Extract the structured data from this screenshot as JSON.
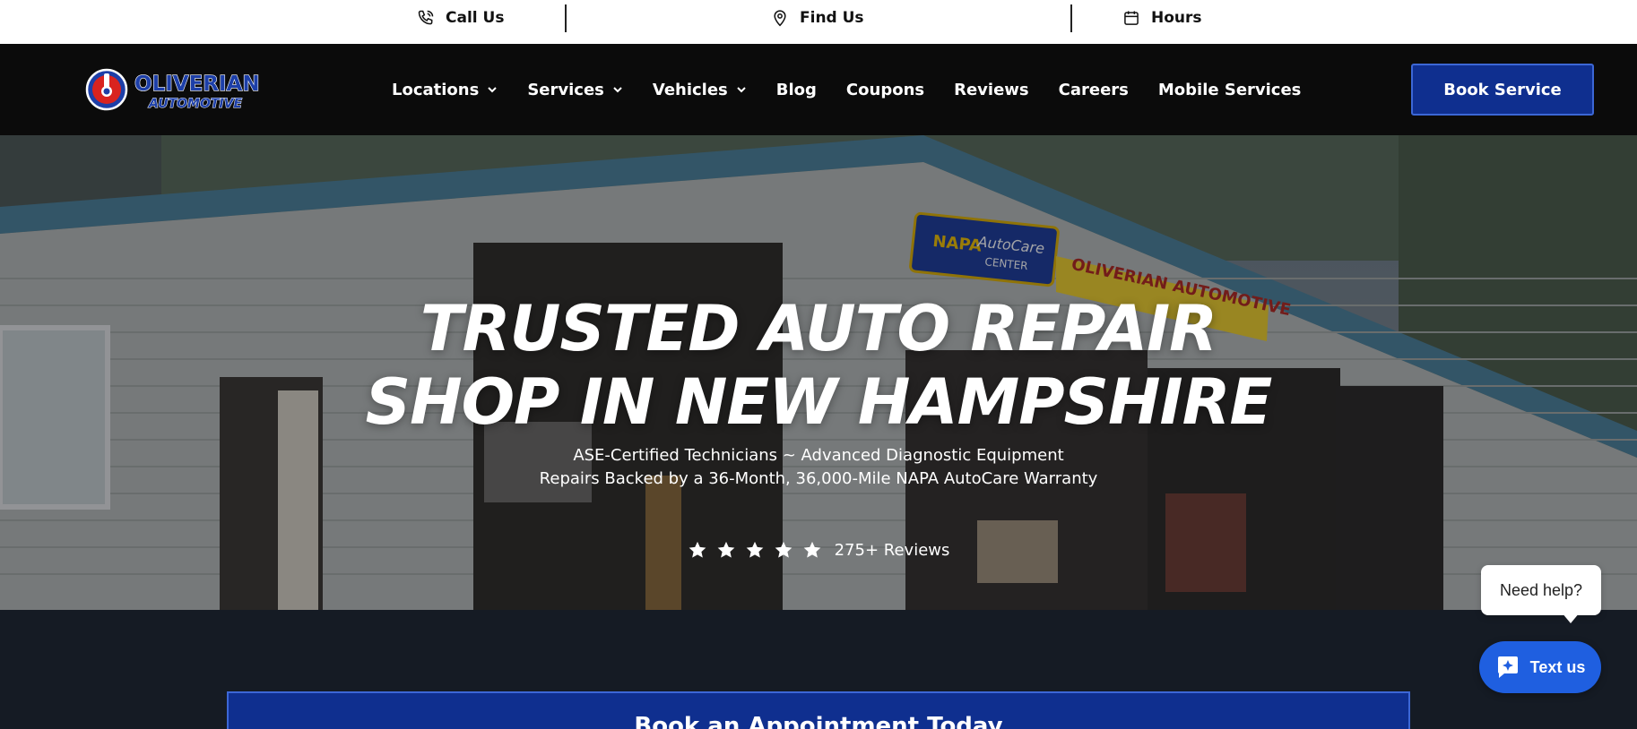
{
  "topbar": {
    "call_label": "Call Us",
    "find_label": "Find Us",
    "hours_label": "Hours"
  },
  "brand": {
    "logo_line1": "OLIVERIAN",
    "logo_line2": "AUTOMOTIVE",
    "primary_color": "#0f2f8f",
    "accent_red": "#d9231f"
  },
  "nav": {
    "items": [
      {
        "label": "Locations",
        "has_dropdown": true
      },
      {
        "label": "Services",
        "has_dropdown": true
      },
      {
        "label": "Vehicles",
        "has_dropdown": true
      },
      {
        "label": "Blog",
        "has_dropdown": false
      },
      {
        "label": "Coupons",
        "has_dropdown": false
      },
      {
        "label": "Reviews",
        "has_dropdown": false
      },
      {
        "label": "Careers",
        "has_dropdown": false
      },
      {
        "label": "Mobile Services",
        "has_dropdown": false
      }
    ],
    "book_label": "Book Service"
  },
  "hero": {
    "title_line1": "TRUSTED AUTO REPAIR",
    "title_line2": "SHOP IN NEW HAMPSHIRE",
    "sub_line1": "ASE-Certified Technicians ~ Advanced Diagnostic Equipment",
    "sub_line2": "Repairs Backed by a 36-Month, 36,000-Mile NAPA AutoCare Warranty",
    "stars": 5,
    "reviews_label": "275+ Reviews",
    "sign_napa": "NAPA",
    "sign_autocare": "AutoCare",
    "sign_center": "CENTER",
    "sign_shop": "OLIVERIAN AUTOMOTIVE"
  },
  "appointment": {
    "label": "Book an Appointment Today"
  },
  "chat": {
    "help_label": "Need help?",
    "text_label": "Text us"
  }
}
